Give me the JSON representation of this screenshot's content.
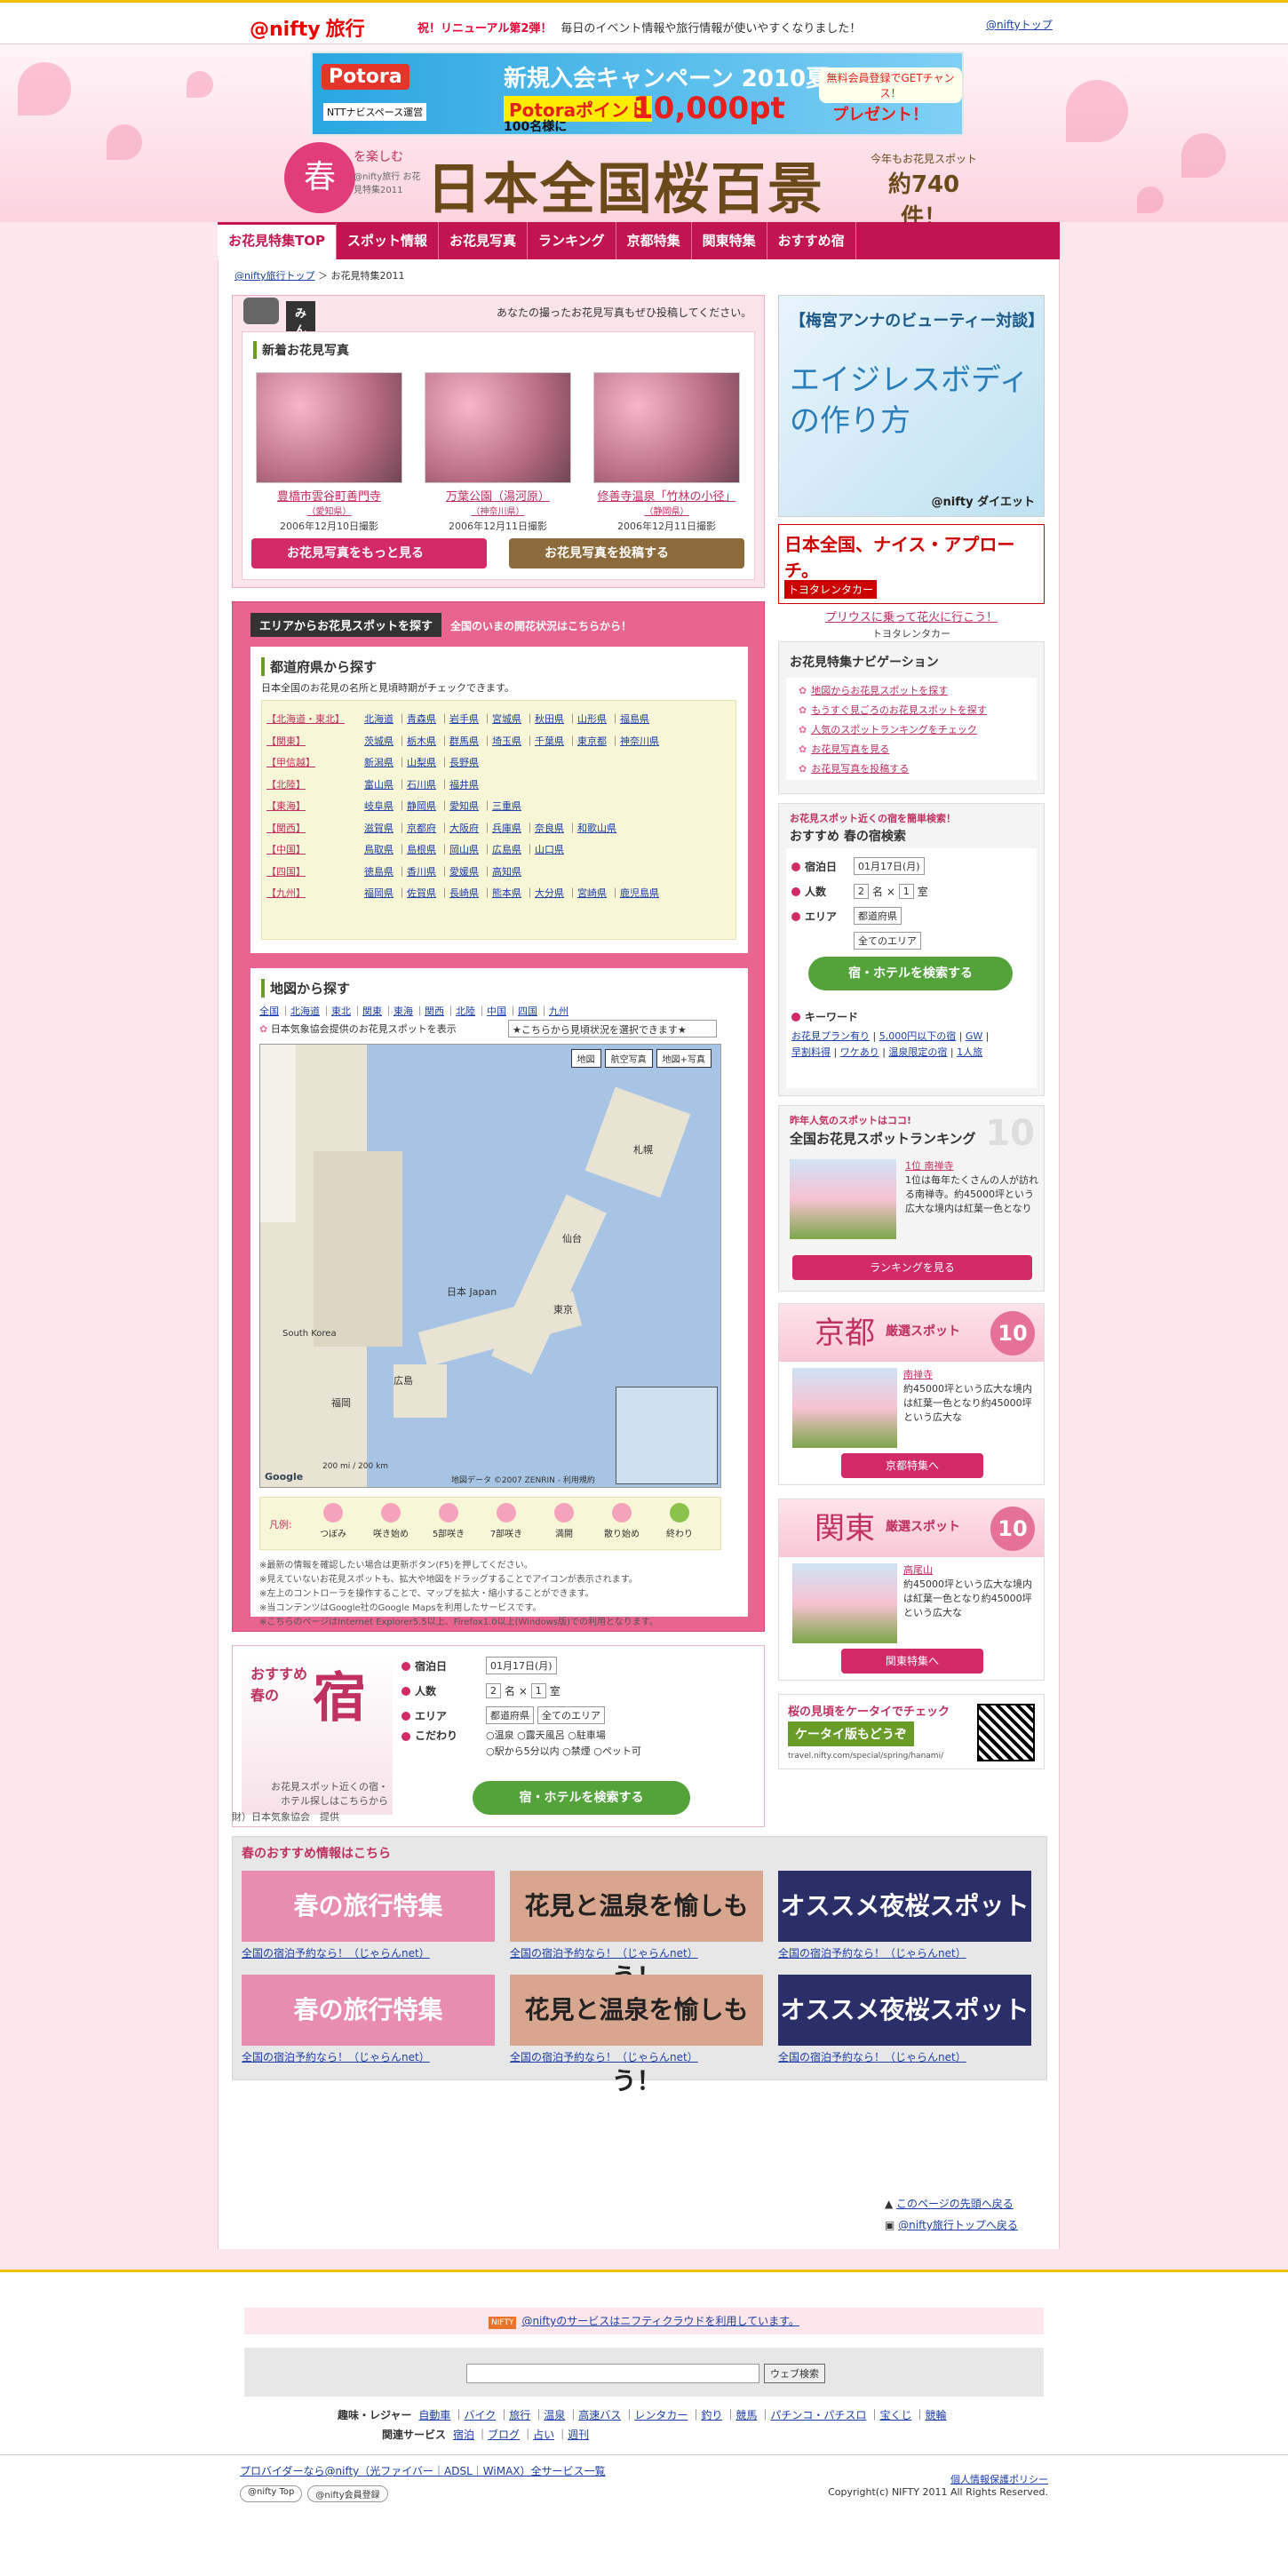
{
  "topbar": {
    "logo": "@nifty",
    "logo_sub": "旅行",
    "news_label": "祝！リニューアル第2弾！",
    "news_text": "毎日のイベント情報や旅行情報が使いやすくなりました！",
    "top_link": "@niftyトップ"
  },
  "banner": {
    "brand": "Potora",
    "tag": "NTTナビスペース運営",
    "campaign": "新規入会キャンペーン 2010夏",
    "points_label": "Potoraポイント",
    "points_value": "10,000pt",
    "winners": "100名様に",
    "present": "プレゼント！",
    "free_join": "無料会員登録でGETチャンス！"
  },
  "title": {
    "haru": "春",
    "sub": "を楽しむ",
    "sub2": "@nifty旅行 お花見特集2011",
    "main": "日本全国桜百景",
    "count_label": "今年もお花見スポット",
    "count_value": "約740件！"
  },
  "nav": {
    "items": [
      {
        "label": "お花見特集TOP"
      },
      {
        "label": "スポット情報"
      },
      {
        "label": "お花見写真"
      },
      {
        "label": "ランキング"
      },
      {
        "label": "京都特集"
      },
      {
        "label": "関東特集"
      },
      {
        "label": "おすすめ宿"
      }
    ]
  },
  "breadcrumb": {
    "home": "@nifty旅行トップ",
    "current": "お花見特集2011"
  },
  "photos": {
    "title": "みんなのお花見写真一覧",
    "subtitle": "あなたの撮ったお花見写真もぜひ投稿してください。",
    "new_label": "新着お花見写真",
    "items": [
      {
        "caption": "豊橋市雲谷町善門寺",
        "pref": "（愛知県）",
        "date": "2006年12月10日撮影"
      },
      {
        "caption": "万葉公園（湯河原）",
        "pref": "（神奈川県）",
        "date": "2006年12月11日撮影"
      },
      {
        "caption": "修善寺温泉「竹林の小径」",
        "pref": "（静岡県）",
        "date": "2006年12月11日撮影"
      }
    ],
    "more_button": "お花見写真をもっと見る",
    "post_button": "お花見写真を投稿する"
  },
  "area": {
    "title": "エリアからお花見スポットを探す",
    "subtitle": "全国のいまの開花状況はこちらから！",
    "pref_title": "都道府県から探す",
    "pref_desc": "日本全国のお花見の名所と見頃時期がチェックできます。",
    "rows": [
      {
        "region": "【北海道・東北】",
        "prefs": [
          "北海道",
          "青森県",
          "岩手県",
          "宮城県",
          "秋田県",
          "山形県",
          "福島県"
        ]
      },
      {
        "region": "【関東】",
        "prefs": [
          "茨城県",
          "栃木県",
          "群馬県",
          "埼玉県",
          "千葉県",
          "東京都",
          "神奈川県"
        ]
      },
      {
        "region": "【甲信越】",
        "prefs": [
          "新潟県",
          "山梨県",
          "長野県"
        ]
      },
      {
        "region": "【北陸】",
        "prefs": [
          "富山県",
          "石川県",
          "福井県"
        ]
      },
      {
        "region": "【東海】",
        "prefs": [
          "岐阜県",
          "静岡県",
          "愛知県",
          "三重県"
        ]
      },
      {
        "region": "【関西】",
        "prefs": [
          "滋賀県",
          "京都府",
          "大阪府",
          "兵庫県",
          "奈良県",
          "和歌山県"
        ]
      },
      {
        "region": "【中国】",
        "prefs": [
          "鳥取県",
          "島根県",
          "岡山県",
          "広島県",
          "山口県"
        ]
      },
      {
        "region": "【四国】",
        "prefs": [
          "徳島県",
          "香川県",
          "愛媛県",
          "高知県"
        ]
      },
      {
        "region": "【九州】",
        "prefs": [
          "福岡県",
          "佐賀県",
          "長崎県",
          "熊本県",
          "大分県",
          "宮崎県",
          "鹿児島県"
        ]
      }
    ],
    "map_title": "地図から探す",
    "map_regions": [
      "全国",
      "北海道",
      "東北",
      "関東",
      "東海",
      "関西",
      "北陸",
      "中国",
      "四国",
      "九州"
    ],
    "map_note": "日本気象協会提供のお花見スポットを表示",
    "map_select": "★こちらから見頃状況を選択できます★",
    "map_buttons": [
      "地図",
      "航空写真",
      "地図+写真"
    ],
    "map_labels": {
      "japan": "日本 Japan",
      "korea": "South Korea",
      "sapporo": "札幌",
      "sendai": "仙台",
      "tokyo": "東京",
      "hiroshima": "広島",
      "fukuoka": "福岡"
    },
    "map_copyright": "地図データ ©2007 ZENRIN - 利用規約",
    "map_google": "Google",
    "map_scale": "200 mi / 200 km",
    "legend_label": "凡例:",
    "legend_items": [
      "つぼみ",
      "咲き始め",
      "5部咲き",
      "7部咲き",
      "満開",
      "散り始め",
      "終わり"
    ],
    "notes": [
      "※最新の情報を確認したい場合は更新ボタン(F5)を押してください。",
      "※見えていないお花見スポットも、拡大や地図をドラッグすることでアイコンが表示されます。",
      "※左上のコントローラを操作することで、マップを拡大・縮小することができます。",
      "※当コンテンツはGoogle社のGoogle Mapsを利用したサービスです。",
      "※こちらのページはInternet Explorer5.5以上、Firefox1.0以上(Windows版)での利用となります。"
    ]
  },
  "yado": {
    "label1": "おすすめ",
    "label2": "春の",
    "label3": "宿",
    "desc": "お花見スポット近くの宿・ホテル探しはこちらから",
    "fields": {
      "checkin_label": "宿泊日",
      "checkin_value": "01月17日(月)",
      "people_label": "人数",
      "people_value": "2",
      "people_unit": "名 ×",
      "rooms_value": "1",
      "rooms_unit": "室",
      "area_label": "エリア",
      "area_pref": "都道府県",
      "area_all": "全てのエリア",
      "cond_label": "こだわり",
      "conds": [
        "温泉",
        "露天風呂",
        "駐車場",
        "駅から5分以内",
        "禁煙",
        "ペット可"
      ]
    },
    "search_button": "宿・ホテルを検索する"
  },
  "credit": "財）日本気象協会　提供",
  "recommend": {
    "title": "春のおすすめ情報はこちら",
    "cards": [
      {
        "image_text": "春の旅行特集",
        "link": "全国の宿泊予約なら！（じゃらんnet）"
      },
      {
        "image_text": "花見と温泉を愉しもう！",
        "link": "全国の宿泊予約なら！（じゃらんnet）"
      },
      {
        "image_text": "オススメ夜桜スポット",
        "link": "全国の宿泊予約なら！（じゃらんnet）"
      },
      {
        "image_text": "春の旅行特集",
        "link": "全国の宿泊予約なら！（じゃらんnet）"
      },
      {
        "image_text": "花見と温泉を愉しもう！",
        "link": "全国の宿泊予約なら！（じゃらんnet）"
      },
      {
        "image_text": "オススメ夜桜スポット",
        "link": "全国の宿泊予約なら！（じゃらんnet）"
      }
    ]
  },
  "back": {
    "page_top": "このページの先頭へ戻る",
    "nifty_top": "@nifty旅行トップへ戻る"
  },
  "right": {
    "anna_title": "【梅宮アンナのビューティー対談】",
    "anna_body": "エイジレスボディの作り方",
    "anna_brand": "@nifty ダイエット",
    "toyota_title": "日本全国、ナイス・アプローチ。",
    "toyota_brand": "トヨタレンタカー",
    "toyota_link": "プリウスに乗って花火に行こう！",
    "toyota_sub": "トヨタレンタカー",
    "navi_title": "お花見特集ナビゲーション",
    "navi_items": [
      "地図からお花見スポットを探す",
      "もうすぐ見ごろのお花見スポットを探す",
      "人気のスポットランキングをチェック",
      "お花見写真を見る",
      "お花見写真を投稿する"
    ],
    "yado_head": "お花見スポット近くの宿を簡単検索！",
    "yado_title": "おすすめ 春の宿検索",
    "keyword_label": "キーワード",
    "keywords": [
      "お花見プラン有り",
      "5,000円以下の宿",
      "GW",
      "早割料得",
      "ワケあり",
      "温泉限定の宿",
      "1人旅"
    ],
    "rank_head": "昨年人気のスポットはココ!",
    "rank_title": "全国お花見スポットランキング",
    "rank_num": "10",
    "rank_first": "1位 南禅寺",
    "rank_desc": "1位は毎年たくさんの人が訪れる南禅寺。約45000坪という広大な境内は紅葉一色となり",
    "rank_button": "ランキングを見る",
    "kyoto_big": "京都",
    "kyoto_sm": "厳選スポット",
    "kyoto_num": "10",
    "kyoto_spot": "南禅寺",
    "kyoto_desc": "約45000坪という広大な境内は紅葉一色となり約45000坪という広大な",
    "kyoto_button": "京都特集へ",
    "kanto_big": "関東",
    "kanto_sm": "厳選スポット",
    "kanto_num": "10",
    "kanto_spot": "高尾山",
    "kanto_desc": "約45000坪という広大な境内は紅葉一色となり約45000坪という広大な",
    "kanto_button": "関東特集へ",
    "mobile_title": "桜の見頃をケータイでチェック",
    "mobile_btn": "ケータイ版もどうぞ",
    "mobile_url": "travel.nifty.com/special/spring/hanami/"
  },
  "footer": {
    "notice_badge": "NIFTY",
    "notice": "@niftyのサービスはニフティクラウドを利用しています。",
    "search_button": "ウェブ検索",
    "hobby_label": "趣味・レジャー",
    "hobby_links": [
      "自動車",
      "バイク",
      "旅行",
      "温泉",
      "高速バス",
      "レンタカー",
      "釣り",
      "競馬",
      "パチンコ・パチスロ",
      "宝くじ",
      "競輪"
    ],
    "related_label": "関連サービス",
    "related_links": [
      "宿泊",
      "ブログ",
      "占い",
      "週刊"
    ],
    "provider": "プロバイダーなら@nifty（光ファイバー｜ADSL｜WiMAX）全サービス一覧",
    "privacy": "個人情報保護ポリシー",
    "copyright": "Copyright(c) NIFTY 2011 All Rights Reserved.",
    "badges": [
      "@nifty Top",
      "@nifty会員登録"
    ]
  }
}
